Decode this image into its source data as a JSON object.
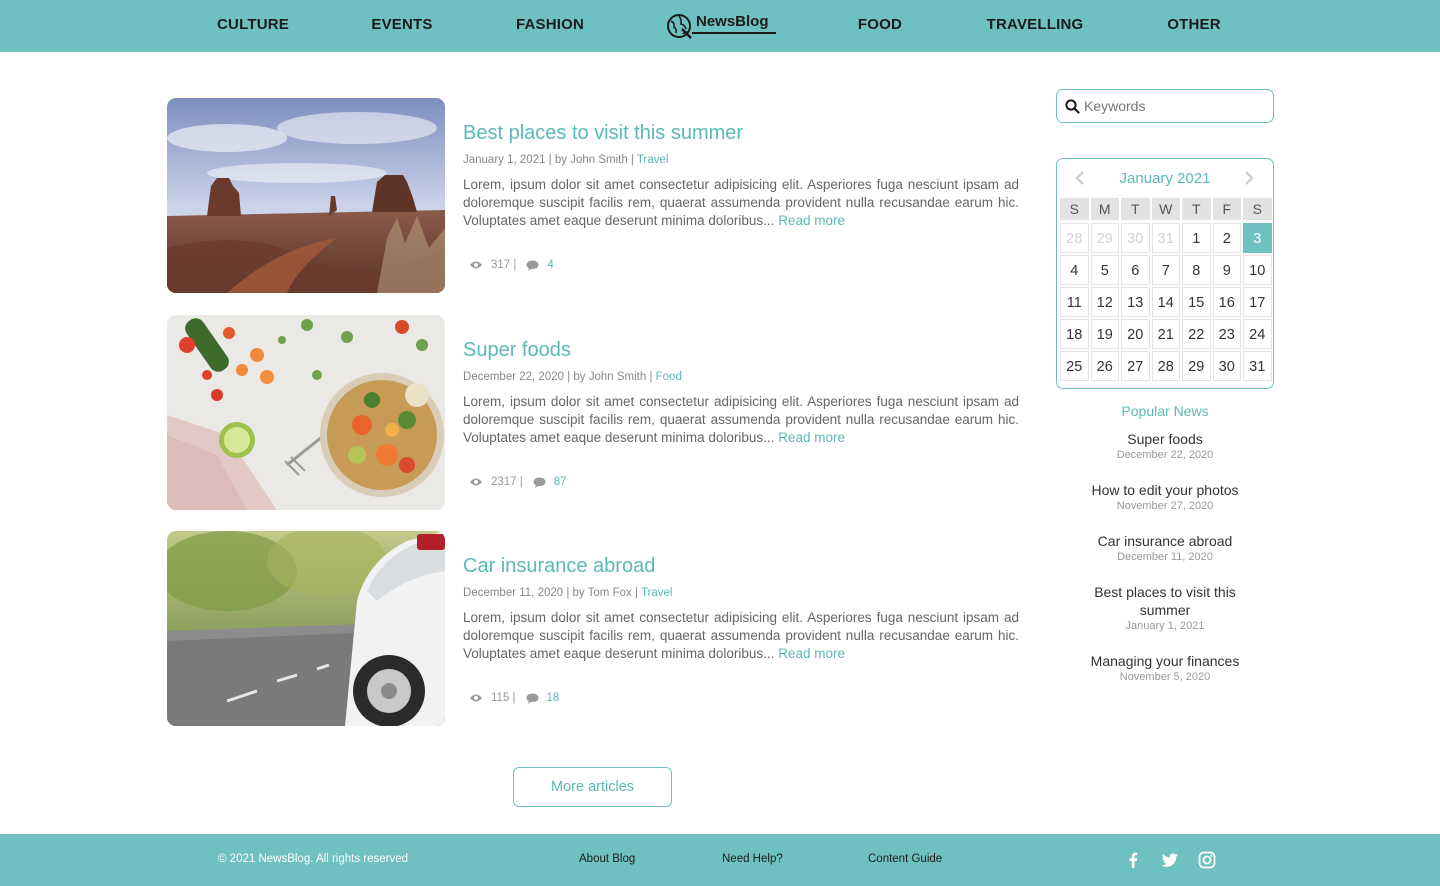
{
  "nav": {
    "items": [
      {
        "label": "CULTURE"
      },
      {
        "label": "EVENTS"
      },
      {
        "label": "FASHION"
      },
      {
        "label": "FOOD"
      },
      {
        "label": "TRAVELLING"
      },
      {
        "label": "OTHER"
      }
    ],
    "logo_text": "NewsBlog"
  },
  "articles": [
    {
      "title": "Best places to visit this summer",
      "meta": "January 1, 2021 | by John Smith | ",
      "category": "Travel",
      "body": "Lorem, ipsum dolor sit amet consectetur adipisicing elit. Asperiores fuga nesciunt ipsam ad doloremque suscipit facilis rem, quaerat assumenda provident nulla recusandae earum hic. Voluptates amet eaque deserunt minima doloribus... ",
      "more": "Read more",
      "views": "317 |",
      "comments": "4"
    },
    {
      "title": "Super foods",
      "meta": "December 22, 2020 | by John Smith | ",
      "category": "Food",
      "body": "Lorem, ipsum dolor sit amet consectetur adipisicing elit. Asperiores fuga nesciunt ipsam ad doloremque suscipit facilis rem, quaerat assumenda provident nulla recusandae earum hic. Voluptates amet eaque deserunt minima doloribus... ",
      "more": "Read more",
      "views": "2317 |",
      "comments": "87"
    },
    {
      "title": "Car insurance abroad",
      "meta": "December 11, 2020 | by Tom Fox | ",
      "category": "Travel",
      "body": "Lorem, ipsum dolor sit amet consectetur adipisicing elit. Asperiores fuga nesciunt ipsam ad doloremque suscipit facilis rem, quaerat assumenda provident nulla recusandae earum hic. Voluptates amet eaque deserunt minima doloribus... ",
      "more": "Read more",
      "views": "115 |",
      "comments": "18"
    }
  ],
  "more_button": "More articles",
  "search": {
    "placeholder": "Keywords"
  },
  "calendar": {
    "month": "January 2021",
    "weekdays": [
      "S",
      "M",
      "T",
      "W",
      "T",
      "F",
      "S"
    ],
    "weeks": [
      [
        "28",
        "29",
        "30",
        "31",
        "1",
        "2",
        "3"
      ],
      [
        "4",
        "5",
        "6",
        "7",
        "8",
        "9",
        "10"
      ],
      [
        "11",
        "12",
        "13",
        "14",
        "15",
        "16",
        "17"
      ],
      [
        "18",
        "19",
        "20",
        "21",
        "22",
        "23",
        "24"
      ],
      [
        "25",
        "26",
        "27",
        "28",
        "29",
        "30",
        "31"
      ]
    ]
  },
  "popular": {
    "title": "Popular News",
    "items": [
      {
        "title": "Super foods",
        "date": "December 22, 2020"
      },
      {
        "title": "How to edit your photos",
        "date": "November 27, 2020"
      },
      {
        "title": "Car insurance abroad",
        "date": "December 11, 2020"
      },
      {
        "title": "Best places to visit this summer",
        "date": "January 1, 2021"
      },
      {
        "title": "Managing your finances",
        "date": "November 5, 2020"
      }
    ]
  },
  "footer": {
    "copyright": "© 2021 NewsBlog. All rights reserved",
    "links": [
      {
        "label": "About Blog"
      },
      {
        "label": "Need Help?"
      },
      {
        "label": "Content Guide"
      }
    ],
    "social": [
      "facebook-icon",
      "twitter-icon",
      "instagram-icon"
    ]
  },
  "colors": {
    "accent": "#6fc0c0",
    "link": "#5bb8b8"
  }
}
